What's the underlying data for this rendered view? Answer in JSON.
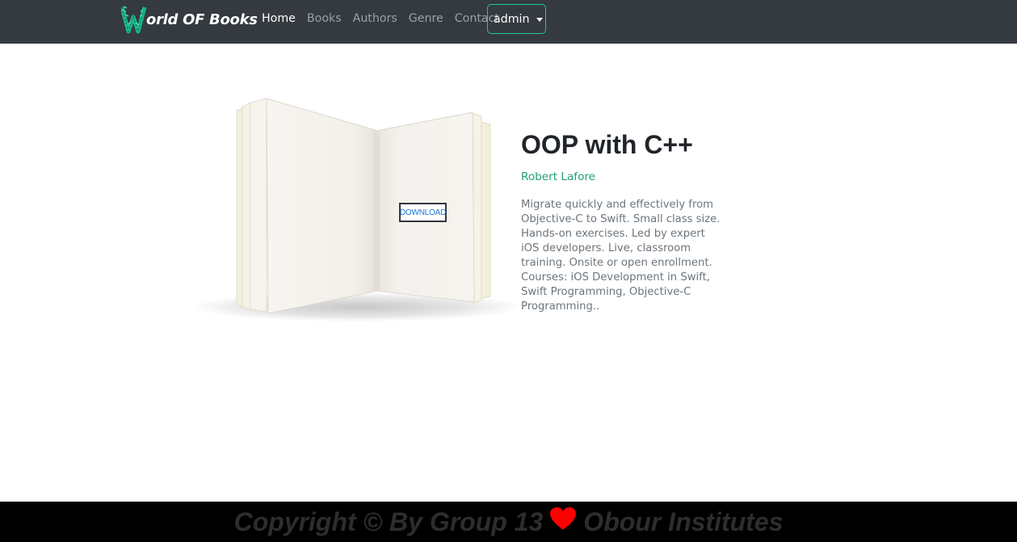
{
  "navbar": {
    "brand_text": "orld OF Books",
    "brand_logo_letter": "W",
    "links": [
      {
        "label": "Home",
        "active": true
      },
      {
        "label": "Books",
        "active": false
      },
      {
        "label": "Authors",
        "active": false
      },
      {
        "label": "Genre",
        "active": false
      },
      {
        "label": "Contact",
        "active": false
      }
    ],
    "user_dropdown": "admin"
  },
  "book": {
    "title": "OOP with C++",
    "author": "Robert Lafore",
    "description": "Migrate quickly and effectively from Objective-C to Swift. Small class size. Hands-on exercises. Led by expert iOS developers. Live, classroom training. Onsite or open enrollment. Courses: iOS Development in Swift, Swift Programming, Objective-C Programming..",
    "download_label": "DOWNLOAD"
  },
  "footer": {
    "text_before": "Copyright © By Group 13",
    "text_after": "Obour Institutes",
    "heart_icon": "heart-icon"
  },
  "colors": {
    "navbar_bg": "#343a40",
    "accent": "#20c997",
    "author": "#1f9d7b",
    "download_text": "#1b78d8",
    "footer_bg": "#000000",
    "heart": "#ff0000"
  }
}
